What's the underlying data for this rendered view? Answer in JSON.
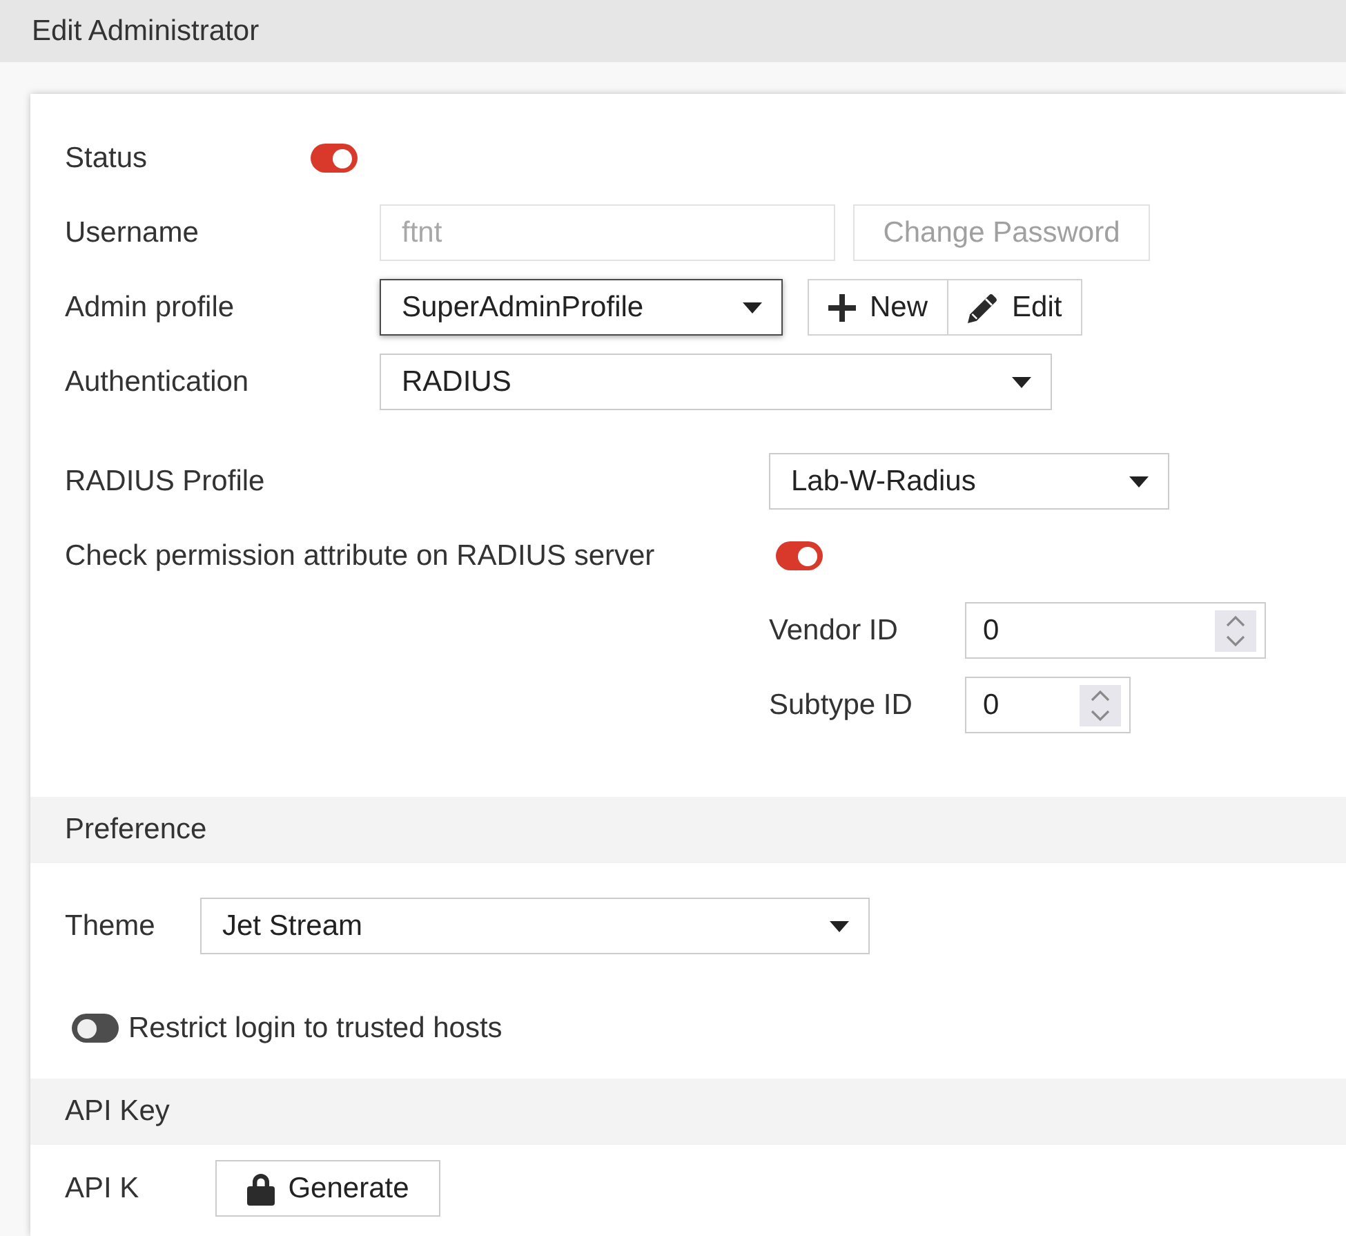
{
  "window": {
    "title": "Edit Administrator"
  },
  "status": {
    "label": "Status",
    "on": true
  },
  "username": {
    "label": "Username",
    "value": "ftnt",
    "disabled": true
  },
  "change_password": {
    "label": "Change Password",
    "disabled": true
  },
  "admin_profile": {
    "label": "Admin profile",
    "value": "SuperAdminProfile",
    "focused": true,
    "buttons": [
      {
        "kind": "add",
        "label": "New"
      },
      {
        "kind": "edit",
        "label": "Edit"
      }
    ]
  },
  "authentication": {
    "label": "Authentication",
    "value": "RADIUS"
  },
  "radius_profile": {
    "label": "RADIUS Profile",
    "value": "Lab-W-Radius"
  },
  "check_permission": {
    "label": "Check permission attribute on RADIUS server",
    "on": true
  },
  "vendor_id": {
    "label": "Vendor ID",
    "value": "0"
  },
  "subtype_id": {
    "label": "Subtype ID",
    "value": "0"
  },
  "preference": {
    "title": "Preference",
    "theme": {
      "label": "Theme",
      "value": "Jet Stream"
    },
    "restrict_login": {
      "label": "Restrict login to trusted hosts",
      "on": false
    }
  },
  "api_key": {
    "title": "API Key",
    "field_label": "API K",
    "button": {
      "kind": "lock",
      "label": "Generate"
    }
  }
}
